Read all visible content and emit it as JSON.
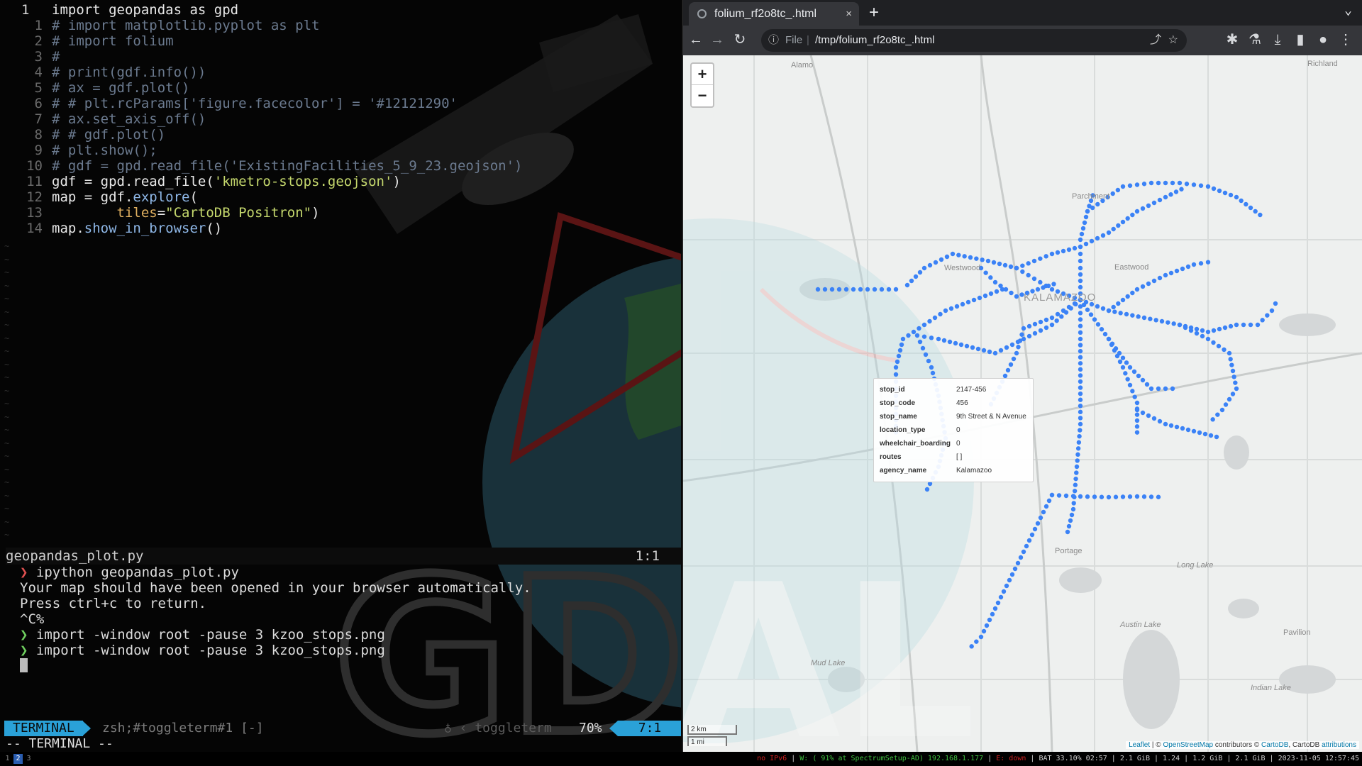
{
  "editor": {
    "lines": [
      {
        "num": "1",
        "parts": [
          {
            "t": "import geopandas as gpd",
            "c": "c-kw"
          }
        ]
      },
      {
        "num": "1",
        "parts": [
          {
            "t": "# import matplotlib.pyplot as plt",
            "c": "c-cm"
          }
        ]
      },
      {
        "num": "2",
        "parts": [
          {
            "t": "# import folium",
            "c": "c-cm"
          }
        ]
      },
      {
        "num": "3",
        "parts": [
          {
            "t": "#",
            "c": "c-cm"
          }
        ]
      },
      {
        "num": "4",
        "parts": [
          {
            "t": "# print(gdf.info())",
            "c": "c-cm"
          }
        ]
      },
      {
        "num": "5",
        "parts": [
          {
            "t": "# ax = gdf.plot()",
            "c": "c-cm"
          }
        ]
      },
      {
        "num": "6",
        "parts": [
          {
            "t": "# # plt.rcParams['figure.facecolor'] = '#12121290'",
            "c": "c-cm"
          }
        ]
      },
      {
        "num": "7",
        "parts": [
          {
            "t": "# ax.set_axis_off()",
            "c": "c-cm"
          }
        ]
      },
      {
        "num": "8",
        "parts": [
          {
            "t": "# # gdf.plot()",
            "c": "c-cm"
          }
        ]
      },
      {
        "num": "9",
        "parts": [
          {
            "t": "# plt.show();",
            "c": "c-cm"
          }
        ]
      },
      {
        "num": "10",
        "parts": [
          {
            "t": "# gdf = gpd.read_file('ExistingFacilities_5_9_23.geojson')",
            "c": "c-cm"
          }
        ]
      },
      {
        "num": "11",
        "parts": [
          {
            "t": "gdf = gpd.read_file(",
            "c": "c-kw"
          },
          {
            "t": "'kmetro-stops.geojson'",
            "c": "c-str"
          },
          {
            "t": ")",
            "c": "c-kw"
          }
        ]
      },
      {
        "num": "12",
        "parts": [
          {
            "t": "map = gdf.",
            "c": "c-kw"
          },
          {
            "t": "explore",
            "c": "c-fn"
          },
          {
            "t": "(",
            "c": "c-kw"
          }
        ]
      },
      {
        "num": "13",
        "parts": [
          {
            "t": "        ",
            "c": "c-kw"
          },
          {
            "t": "tiles",
            "c": "c-arg"
          },
          {
            "t": "=",
            "c": "c-kw"
          },
          {
            "t": "\"CartoDB Positron\"",
            "c": "c-str"
          },
          {
            "t": ")",
            "c": "c-kw"
          }
        ]
      },
      {
        "num": "14",
        "parts": [
          {
            "t": "map.",
            "c": "c-kw"
          },
          {
            "t": "show_in_browser",
            "c": "c-fn"
          },
          {
            "t": "()",
            "c": "c-kw"
          }
        ]
      }
    ],
    "filename": "geopandas_plot.py",
    "cursor_pos": "1:1"
  },
  "terminal": {
    "prompt_symbol": "❯",
    "lines": [
      {
        "prompt": "red",
        "text": "ipython geopandas_plot.py"
      },
      {
        "prompt": "",
        "text": "Your map should have been opened in your browser automatically."
      },
      {
        "prompt": "",
        "text": "Press ctrl+c to return."
      },
      {
        "prompt": "",
        "text": "^C%"
      },
      {
        "prompt": "green",
        "text": "import -window root -pause 3 kzoo_stops.png"
      },
      {
        "prompt": "green",
        "text": "import -window root -pause 3 kzoo_stops.png"
      }
    ]
  },
  "statusline": {
    "mode": "TERMINAL",
    "file": "zsh;#toggleterm#1 [-]",
    "plugin": "♁ ‹ toggleterm",
    "percent": "70%",
    "position": "7:1",
    "modeline": "-- TERMINAL --"
  },
  "browser": {
    "tab_title": "folium_rf2o8tc_.html",
    "tab_close": "×",
    "new_tab": "+",
    "tab_menu": "⌄",
    "url_scheme": "File",
    "url_sep": "|",
    "url_path": "/tmp/folium_rf2o8tc_.html",
    "nav": {
      "back": "←",
      "forward": "→",
      "reload": "↻",
      "info": "ⓘ",
      "share": "⤴",
      "star": "☆",
      "extensions": "✱",
      "lab": "⚗",
      "download": "⤓",
      "sidepanel": "▮",
      "profile": "●",
      "menu": "⋮"
    }
  },
  "map": {
    "zoom_in": "+",
    "zoom_out": "−",
    "place_labels": [
      "Alamo",
      "Richland",
      "Parchment",
      "Westwood",
      "Eastwood",
      "KALAMAZOO",
      "Portage",
      "Long Lake",
      "Austin Lake",
      "Pavilion",
      "Mud Lake",
      "Indian Lake"
    ],
    "popup": [
      {
        "key": "stop_id",
        "value": "2147-456"
      },
      {
        "key": "stop_code",
        "value": "456"
      },
      {
        "key": "stop_name",
        "value": "9th Street & N Avenue"
      },
      {
        "key": "location_type",
        "value": "0"
      },
      {
        "key": "wheelchair_boarding",
        "value": "0"
      },
      {
        "key": "routes",
        "value": "[ ]"
      },
      {
        "key": "agency_name",
        "value": "Kalamazoo"
      }
    ],
    "scale_km": "2 km",
    "scale_mi": "1 mi",
    "attribution": {
      "leaflet": "Leaflet",
      "sep1": " | © ",
      "osm": "OpenStreetMap",
      "contrib": " contributors © ",
      "carto": "CartoDB",
      "carto2": ", CartoDB ",
      "attr": "attributions"
    },
    "stop_color": "#3b82f6"
  },
  "bottombar": {
    "workspaces": [
      "1",
      "2",
      "3"
    ],
    "active_workspace": "2",
    "ipv6": "no IPv6",
    "wifi": "W: ( 91% at SpectrumSetup-AD) 192.168.1.177",
    "eth": "E: down",
    "rest": "BAT 33.10% 02:57 | 2.1 GiB | 1.24 | 1.2 GiB | 2.1 GiB | 2023-11-05 12:57:45"
  },
  "colors": {
    "accent": "#2aa1d8",
    "browser_chrome": "#35363a",
    "stop": "#3b82f6"
  }
}
